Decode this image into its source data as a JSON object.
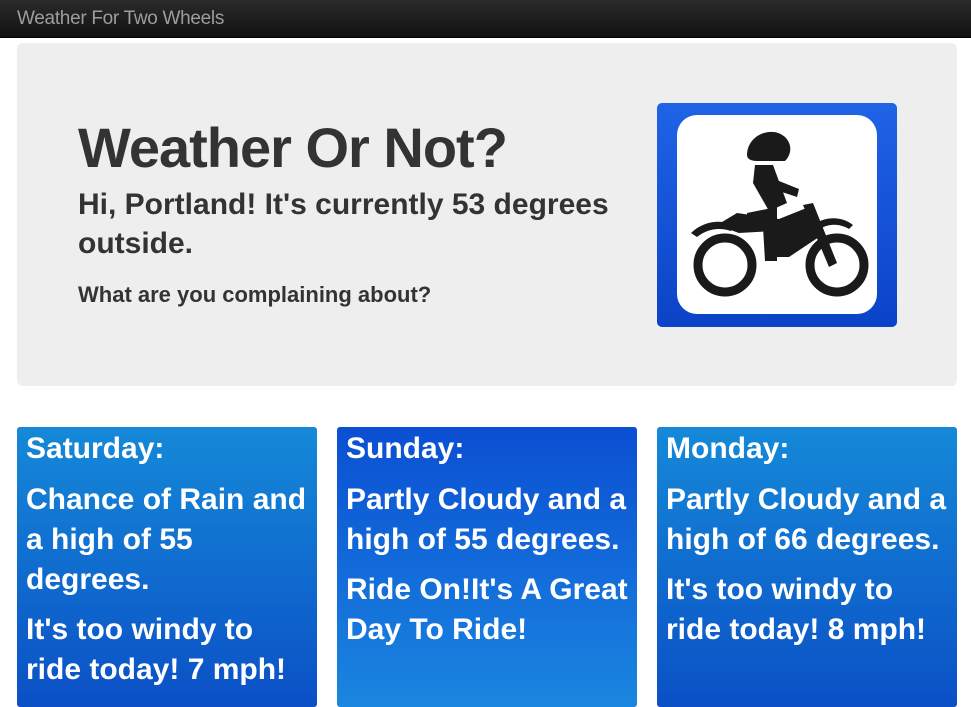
{
  "navbar": {
    "brand": "Weather For Two Wheels"
  },
  "hero": {
    "title": "Weather Or Not?",
    "subtitle": "Hi, Portland! It's currently 53 degrees outside.",
    "question": "What are you complaining about?",
    "sign_icon": "motorcycle-rider-icon",
    "sign_color": "#0b43c8"
  },
  "forecast": [
    {
      "day": "Saturday:",
      "forecast": "Chance of Rain and a high of 55 degrees.",
      "advice": "It's too windy to ride today! 7 mph!"
    },
    {
      "day": "Sunday:",
      "forecast": "Partly Cloudy and a high of 55 degrees.",
      "advice": "Ride On!It's A Great Day To Ride!"
    },
    {
      "day": "Monday:",
      "forecast": "Partly Cloudy and a high of 66 degrees.",
      "advice": "It's too windy to ride today! 8 mph!"
    }
  ],
  "colors": {
    "navbar": "#1b1b1b",
    "hero_bg": "#eeeeee",
    "card_blue": "#0b50c6",
    "text_dark": "#333333"
  }
}
